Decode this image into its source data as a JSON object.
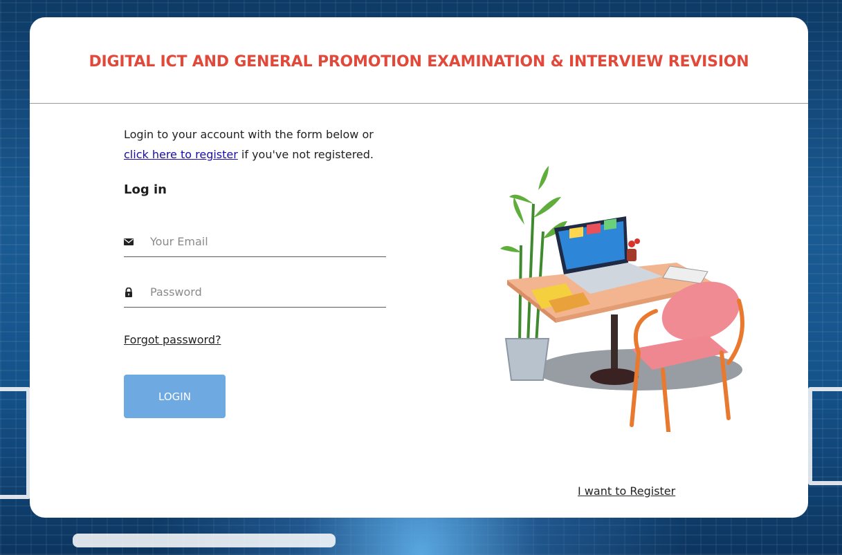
{
  "header": {
    "title": "DIGITAL ICT AND GENERAL PROMOTION EXAMINATION & INTERVIEW REVISION"
  },
  "intro": {
    "line1": "Login to your account with the form below or",
    "register_link": "click here to register",
    "line2_suffix": " if you've not registered."
  },
  "login_form": {
    "heading": "Log in",
    "email": {
      "placeholder": "Your Email",
      "value": "",
      "icon": "envelope-icon"
    },
    "password": {
      "placeholder": "Password",
      "value": "",
      "icon": "lock-icon"
    },
    "forgot_label": "Forgot password?",
    "submit_label": "LOGIN"
  },
  "footer": {
    "register_label": "I want to Register"
  },
  "colors": {
    "title": "#e1493a",
    "button": "#6fa9e2",
    "link": "#1a0dab"
  }
}
